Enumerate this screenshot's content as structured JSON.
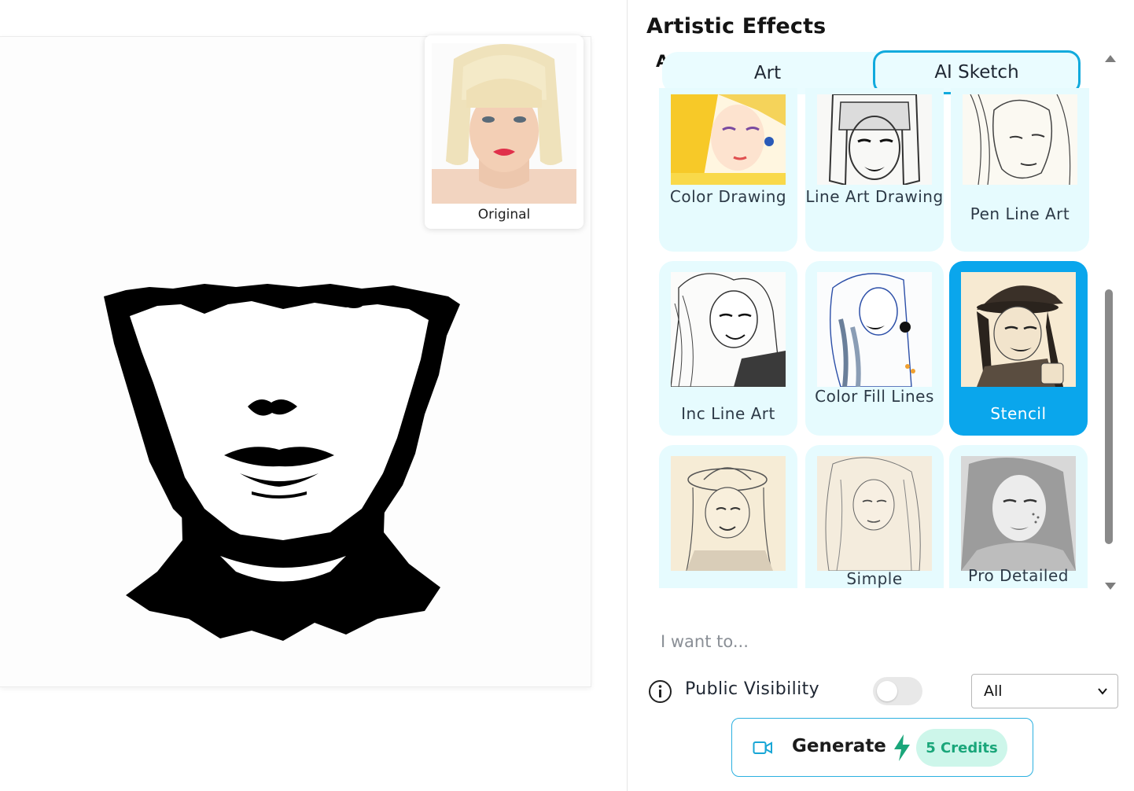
{
  "canvas": {
    "original_label": "Original"
  },
  "panel": {
    "title": "Artistic Effects",
    "hidden_subtitle": "A"
  },
  "tabs": [
    {
      "label": "Art",
      "active": false
    },
    {
      "label": "AI Sketch",
      "active": true
    }
  ],
  "effects": [
    {
      "label": "Color Drawing",
      "selected": false,
      "icon": "color-drawing-thumb"
    },
    {
      "label": "Line Art Drawing",
      "selected": false,
      "icon": "line-art-drawing-thumb"
    },
    {
      "label": "Pen Line Art",
      "selected": false,
      "icon": "pen-line-art-thumb"
    },
    {
      "label": "Inc Line Art",
      "selected": false,
      "icon": "inc-line-art-thumb"
    },
    {
      "label": "Color Fill Lines",
      "selected": false,
      "icon": "color-fill-lines-thumb"
    },
    {
      "label": "Stencil",
      "selected": true,
      "icon": "stencil-thumb"
    },
    {
      "label": "",
      "selected": false,
      "icon": "sketch-hat-thumb"
    },
    {
      "label": "Simple",
      "selected": false,
      "icon": "simple-thumb"
    },
    {
      "label": "Pro Detailed",
      "selected": false,
      "icon": "pro-detailed-thumb"
    }
  ],
  "prompt": {
    "placeholder": "I want to..."
  },
  "visibility": {
    "label": "Public Visibility",
    "enabled": false,
    "select_value": "All"
  },
  "generate": {
    "label": "Generate",
    "credits": "5 Credits"
  },
  "colors": {
    "accent": "#0aa6ec",
    "card_bg": "#e6fbfe",
    "credits_text": "#1aa67a",
    "credits_bg": "#cdf6ea"
  }
}
